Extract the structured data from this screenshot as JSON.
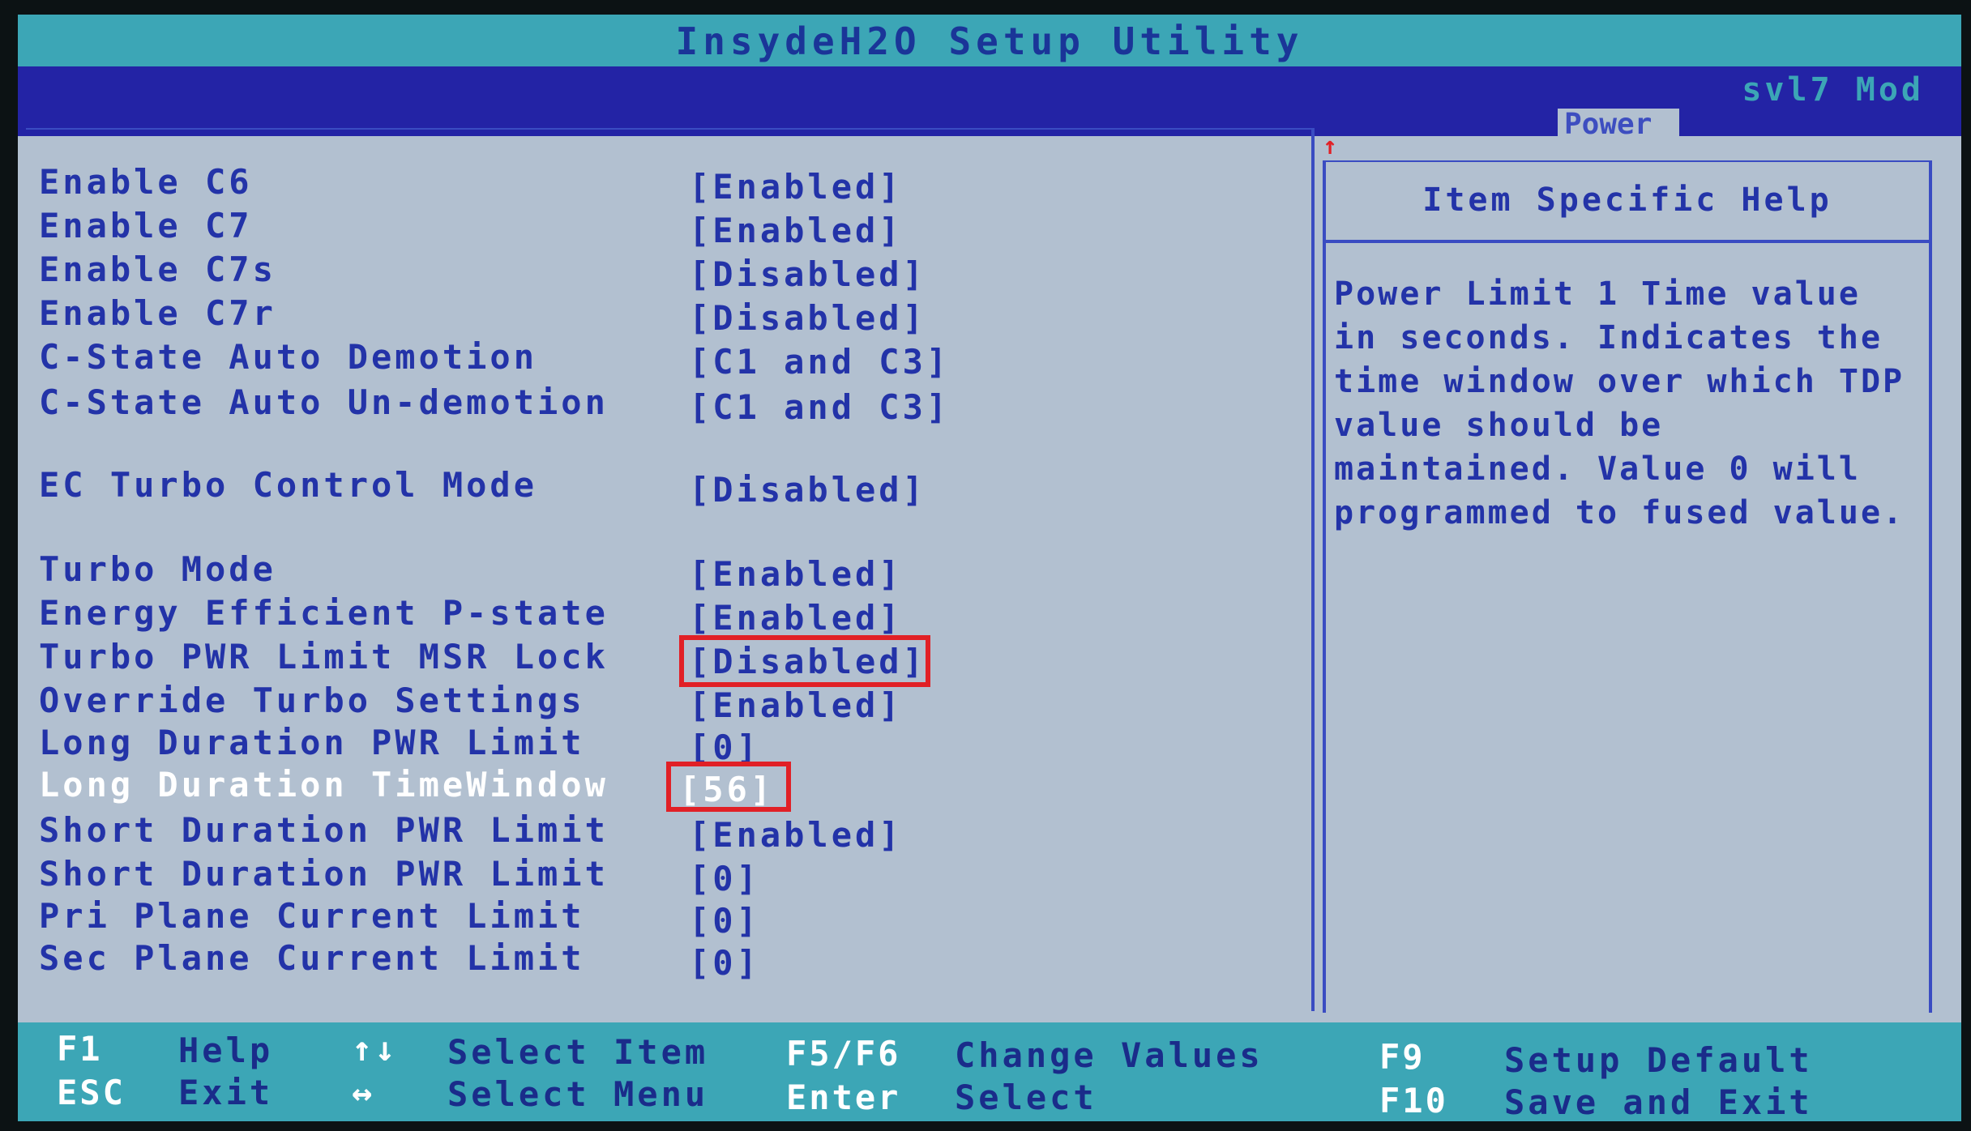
{
  "title": "InsydeH2O Setup Utility",
  "model": "svl7 Mod",
  "active_tab": "Power",
  "settings": [
    {
      "label": "Enable C6",
      "value": "[Enabled]"
    },
    {
      "label": "Enable C7",
      "value": "[Enabled]"
    },
    {
      "label": "Enable C7s",
      "value": "[Disabled]"
    },
    {
      "label": "Enable C7r",
      "value": "[Disabled]"
    },
    {
      "label": "C-State Auto Demotion",
      "value": "[C1 and C3]"
    },
    {
      "label": "C-State Auto Un-demotion",
      "value": "[C1 and C3]"
    },
    {
      "label": "EC Turbo Control Mode",
      "value": "[Disabled]"
    },
    {
      "label": "Turbo Mode",
      "value": "[Enabled]"
    },
    {
      "label": "Energy Efficient P-state",
      "value": "[Enabled]"
    },
    {
      "label": "Turbo PWR Limit MSR Lock",
      "value": "[Disabled]"
    },
    {
      "label": "Override Turbo Settings",
      "value": "[Enabled]"
    },
    {
      "label": "Long Duration PWR Limit",
      "value": "[0]"
    },
    {
      "label": "Long Duration TimeWindow",
      "value": "[56]"
    },
    {
      "label": "Short Duration PWR Limit",
      "value": "[Enabled]"
    },
    {
      "label": "Short Duration PWR Limit",
      "value": "[0]"
    },
    {
      "label": "Pri Plane Current Limit",
      "value": "[0]"
    },
    {
      "label": "Sec Plane Current Limit",
      "value": "[0]"
    }
  ],
  "help": {
    "title": "Item Specific Help",
    "text": "Power Limit 1 Time value in seconds. Indicates the time window over which TDP value should be maintained. Value 0 will programmed to fused value."
  },
  "footer": {
    "f1_key": "F1",
    "f1_desc": "Help",
    "esc_key": "ESC",
    "esc_desc": "Exit",
    "updown_key": "↑↓",
    "updown_desc": "Select Item",
    "leftright_key": "↔",
    "leftright_desc": "Select Menu",
    "f5f6_key": "F5/F6",
    "f5f6_desc": "Change Values",
    "enter_key": "Enter",
    "enter_desc": "Select",
    "f9_key": "F9",
    "f9_desc": "Setup Default",
    "f10_key": "F10",
    "f10_desc": "Save and Exit"
  },
  "colors": {
    "screen_bg": "#b2c0d0",
    "title_bar": "#3ca6b6",
    "menu_bar": "#2323a5",
    "text": "#2333a8",
    "highlight_box": "#e12026",
    "active_text": "#ffffff"
  }
}
